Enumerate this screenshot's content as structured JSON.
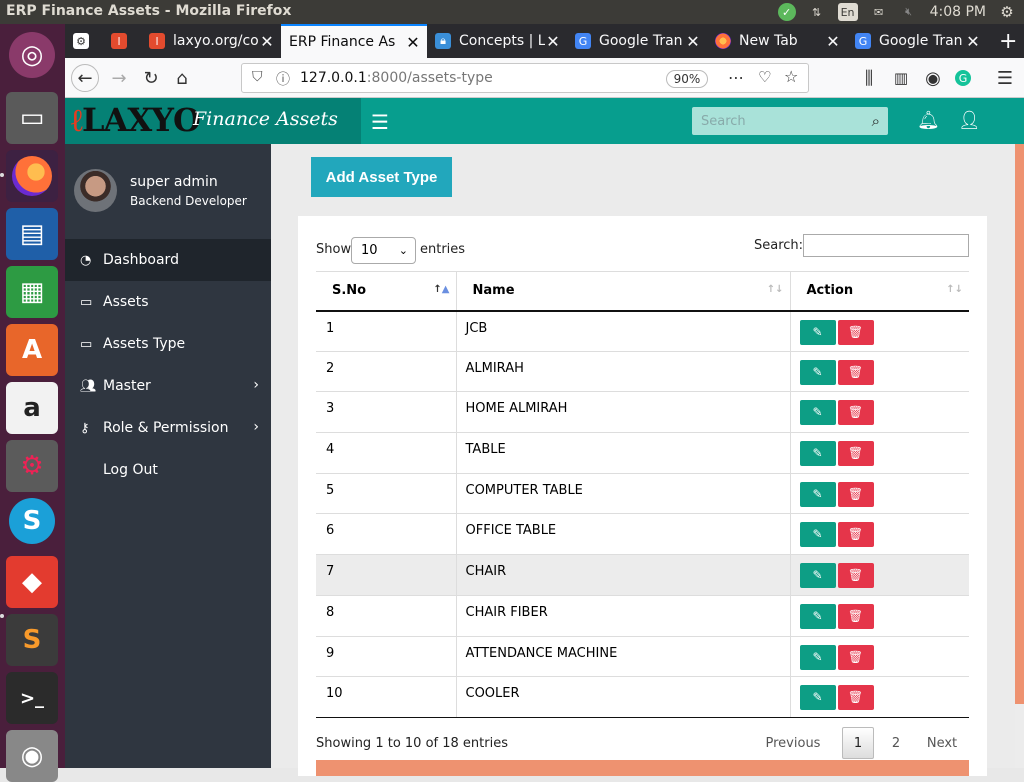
{
  "os": {
    "window_title": "ERP Finance Assets - Mozilla Firefox",
    "keyboard_layout": "En",
    "clock": "4:08 PM"
  },
  "browser": {
    "tabs": [
      {
        "label": "",
        "icon": "extension-icon"
      },
      {
        "label": "",
        "icon": "laxyo-icon"
      },
      {
        "label": "laxyo.org/co",
        "icon": "laxyo-icon"
      },
      {
        "label": "ERP Finance As",
        "icon": "none",
        "active": true
      },
      {
        "label": "Concepts | L",
        "icon": "lock-icon"
      },
      {
        "label": "Google Tran",
        "icon": "google-translate-icon"
      },
      {
        "label": "New Tab",
        "icon": "firefox-icon"
      },
      {
        "label": "Google Tran",
        "icon": "google-translate-icon"
      }
    ],
    "url_host": "127.0.0.1",
    "url_rest": ":8000/assets-type",
    "zoom": "90%"
  },
  "app": {
    "logo_text": "LAXYO",
    "product_name": "Finance Assets",
    "search_placeholder": "Search",
    "accent_color": "#079e8e"
  },
  "sidebar": {
    "user_name": "super admin",
    "user_role": "Backend Developer",
    "items": [
      {
        "label": "Dashboard",
        "icon": "dashboard-icon",
        "active": true
      },
      {
        "label": "Assets",
        "icon": "laptop-icon"
      },
      {
        "label": "Assets Type",
        "icon": "laptop-icon"
      },
      {
        "label": "Master",
        "icon": "users-icon",
        "submenu": true
      },
      {
        "label": "Role & Permission",
        "icon": "key-icon",
        "submenu": true
      },
      {
        "label": "Log Out",
        "icon": "none"
      }
    ]
  },
  "main": {
    "add_button": "Add Asset Type",
    "show_label": "Show",
    "entries_value": "10",
    "entries_label": "entries",
    "search_label": "Search:",
    "columns": [
      "S.No",
      "Name",
      "Action"
    ],
    "rows": [
      {
        "sno": "1",
        "name": "JCB"
      },
      {
        "sno": "2",
        "name": "ALMIRAH"
      },
      {
        "sno": "3",
        "name": "HOME ALMIRAH"
      },
      {
        "sno": "4",
        "name": "TABLE"
      },
      {
        "sno": "5",
        "name": "COMPUTER TABLE"
      },
      {
        "sno": "6",
        "name": "OFFICE TABLE"
      },
      {
        "sno": "7",
        "name": "CHAIR"
      },
      {
        "sno": "8",
        "name": "CHAIR FIBER"
      },
      {
        "sno": "9",
        "name": "ATTENDANCE MACHINE"
      },
      {
        "sno": "10",
        "name": "COOLER"
      }
    ],
    "info": "Showing 1 to 10 of 18 entries",
    "pagination": {
      "previous": "Previous",
      "pages": [
        "1",
        "2"
      ],
      "current": "1",
      "next": "Next"
    }
  }
}
